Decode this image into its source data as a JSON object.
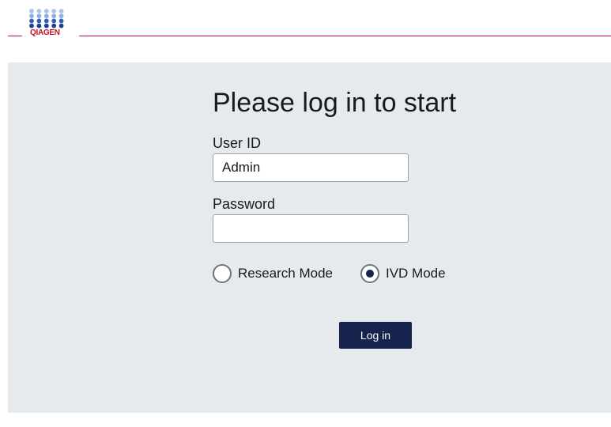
{
  "header": {
    "brand": "QIAGEN",
    "brand_color": "#c8102e",
    "logo_icon": "qiagen-dot-grid-icon"
  },
  "login": {
    "title": "Please log in to start",
    "user_id_label": "User ID",
    "user_id_value": "Admin",
    "password_label": "Password",
    "password_value": "",
    "modes": {
      "research_label": "Research Mode",
      "ivd_label": "IVD Mode",
      "selected": "IVD Mode"
    },
    "login_button_label": "Log in"
  },
  "colors": {
    "panel_bg": "#e6eaed",
    "primary": "#16244d",
    "accent_line": "#c8102e"
  }
}
